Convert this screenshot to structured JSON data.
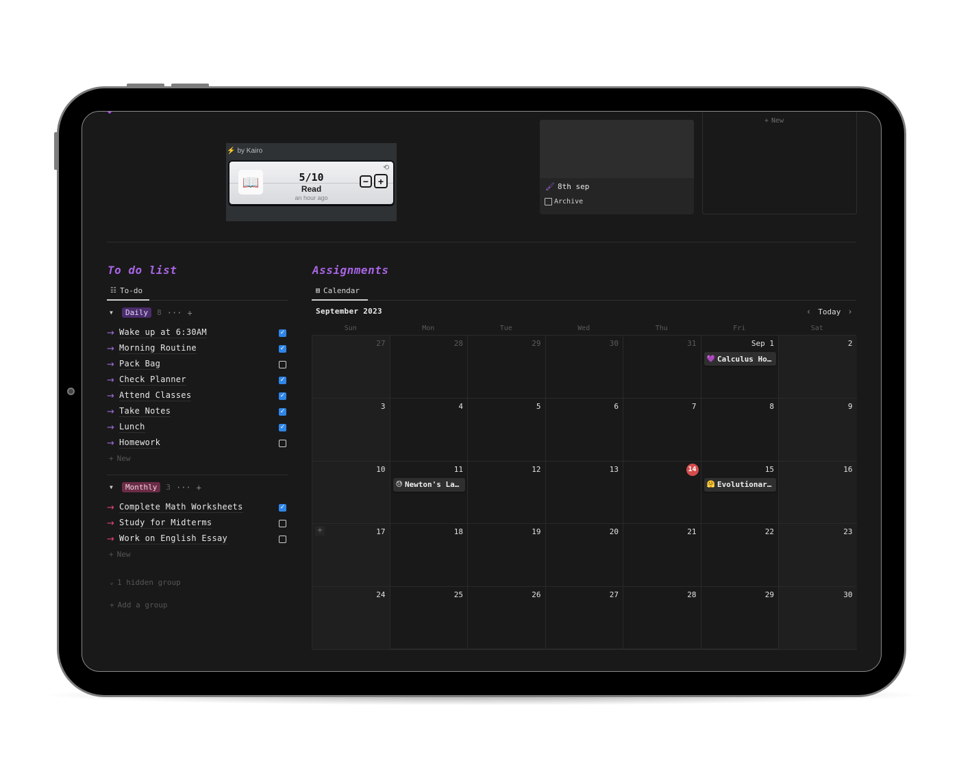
{
  "widget": {
    "author": "by Kairo",
    "icon": "open-book-icon",
    "icon_glyph": "📖",
    "progress_current": 5,
    "progress_total": 10,
    "count_text": "5/10",
    "label": "Read",
    "updated": "an hour ago",
    "minus_label": "−",
    "plus_label": "+",
    "refresh_glyph": "⟲"
  },
  "gallery": {
    "card_title": "8th sep",
    "card_icon": "paintbrush-icon",
    "card_property": "Archive",
    "card_property_checked": false,
    "new_label": "New"
  },
  "todo": {
    "title": "To do list",
    "view_tab": "To-do",
    "groups": [
      {
        "name": "Daily",
        "count": "8",
        "color": "#4a2d6d",
        "arrow_color": "#a56be0",
        "items": [
          {
            "text": "Wake up at 6:30AM",
            "done": true
          },
          {
            "text": "Morning Routine",
            "done": true
          },
          {
            "text": "Pack Bag",
            "done": false
          },
          {
            "text": "Check Planner",
            "done": true
          },
          {
            "text": "Attend Classes",
            "done": true
          },
          {
            "text": "Take Notes",
            "done": true
          },
          {
            "text": "Lunch",
            "done": true
          },
          {
            "text": "Homework",
            "done": false
          }
        ],
        "new_label": "New"
      },
      {
        "name": "Monthly",
        "count": "3",
        "color": "#6b2c47",
        "arrow_color": "#e0457f",
        "items": [
          {
            "text": "Complete Math Worksheets",
            "done": true
          },
          {
            "text": "Study for Midterms",
            "done": false
          },
          {
            "text": "Work on English Essay",
            "done": false
          }
        ],
        "new_label": "New"
      }
    ],
    "hidden_groups": "1 hidden group",
    "add_group": "Add a group"
  },
  "assignments": {
    "title": "Assignments",
    "view_tab": "Calendar",
    "month_label": "September 2023",
    "today_label": "Today",
    "weekdays": [
      "Sun",
      "Mon",
      "Tue",
      "Wed",
      "Thu",
      "Fri",
      "Sat"
    ],
    "today_date": "14",
    "weeks": [
      [
        {
          "d": "27",
          "dim": true
        },
        {
          "d": "28",
          "dim": true
        },
        {
          "d": "29",
          "dim": true
        },
        {
          "d": "30",
          "dim": true
        },
        {
          "d": "31",
          "dim": true
        },
        {
          "d": "Sep 1"
        },
        {
          "d": "2"
        }
      ],
      [
        {
          "d": "3"
        },
        {
          "d": "4"
        },
        {
          "d": "5"
        },
        {
          "d": "6"
        },
        {
          "d": "7"
        },
        {
          "d": "8"
        },
        {
          "d": "9"
        }
      ],
      [
        {
          "d": "10"
        },
        {
          "d": "11"
        },
        {
          "d": "12"
        },
        {
          "d": "13"
        },
        {
          "d": "14",
          "today": true
        },
        {
          "d": "15"
        },
        {
          "d": "16"
        }
      ],
      [
        {
          "d": "17",
          "add": true
        },
        {
          "d": "18"
        },
        {
          "d": "19"
        },
        {
          "d": "20"
        },
        {
          "d": "21"
        },
        {
          "d": "22"
        },
        {
          "d": "23"
        }
      ],
      [
        {
          "d": "24"
        },
        {
          "d": "25"
        },
        {
          "d": "26"
        },
        {
          "d": "27"
        },
        {
          "d": "28"
        },
        {
          "d": "29"
        },
        {
          "d": "30"
        }
      ]
    ],
    "events": [
      {
        "week": 0,
        "day": 5,
        "emoji": "💜",
        "title": "Calculus Ho…"
      },
      {
        "week": 2,
        "day": 1,
        "emoji": "😓",
        "title": "Newton's La…"
      },
      {
        "week": 2,
        "day": 5,
        "emoji": "🤗",
        "title": "Evolutionar…"
      }
    ]
  }
}
